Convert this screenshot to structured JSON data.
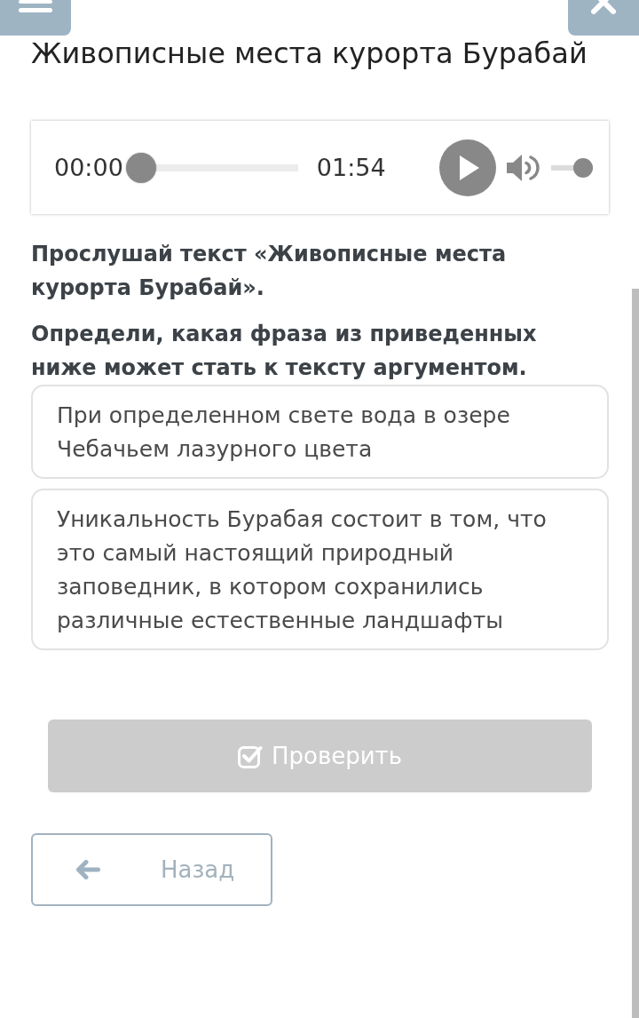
{
  "title": "Живописные места курорта Бурабай",
  "audio_player": {
    "current_time": "00:00",
    "duration": "01:54",
    "playing": false,
    "progress": {
      "level": 0
    },
    "volume": {
      "level": 1
    }
  },
  "instructions": [
    "Прослушай текст «Живописные места курорта Бурабай».",
    "Определи, какая фраза из приведенных ниже может стать к тексту аргументом."
  ],
  "options": [
    {
      "text": "При определенном свете вода в озере Чебачьем лазурного цвета",
      "selected": false
    },
    {
      "text": "Уникальность Бурабая состоит в том, что это самый настоящий природный заповедник, в котором сохранились различные естественные ландшафты",
      "selected": false
    }
  ],
  "check_button": {
    "label": "Проверить",
    "disabled": true
  },
  "back_button": {
    "label": "Назад"
  }
}
